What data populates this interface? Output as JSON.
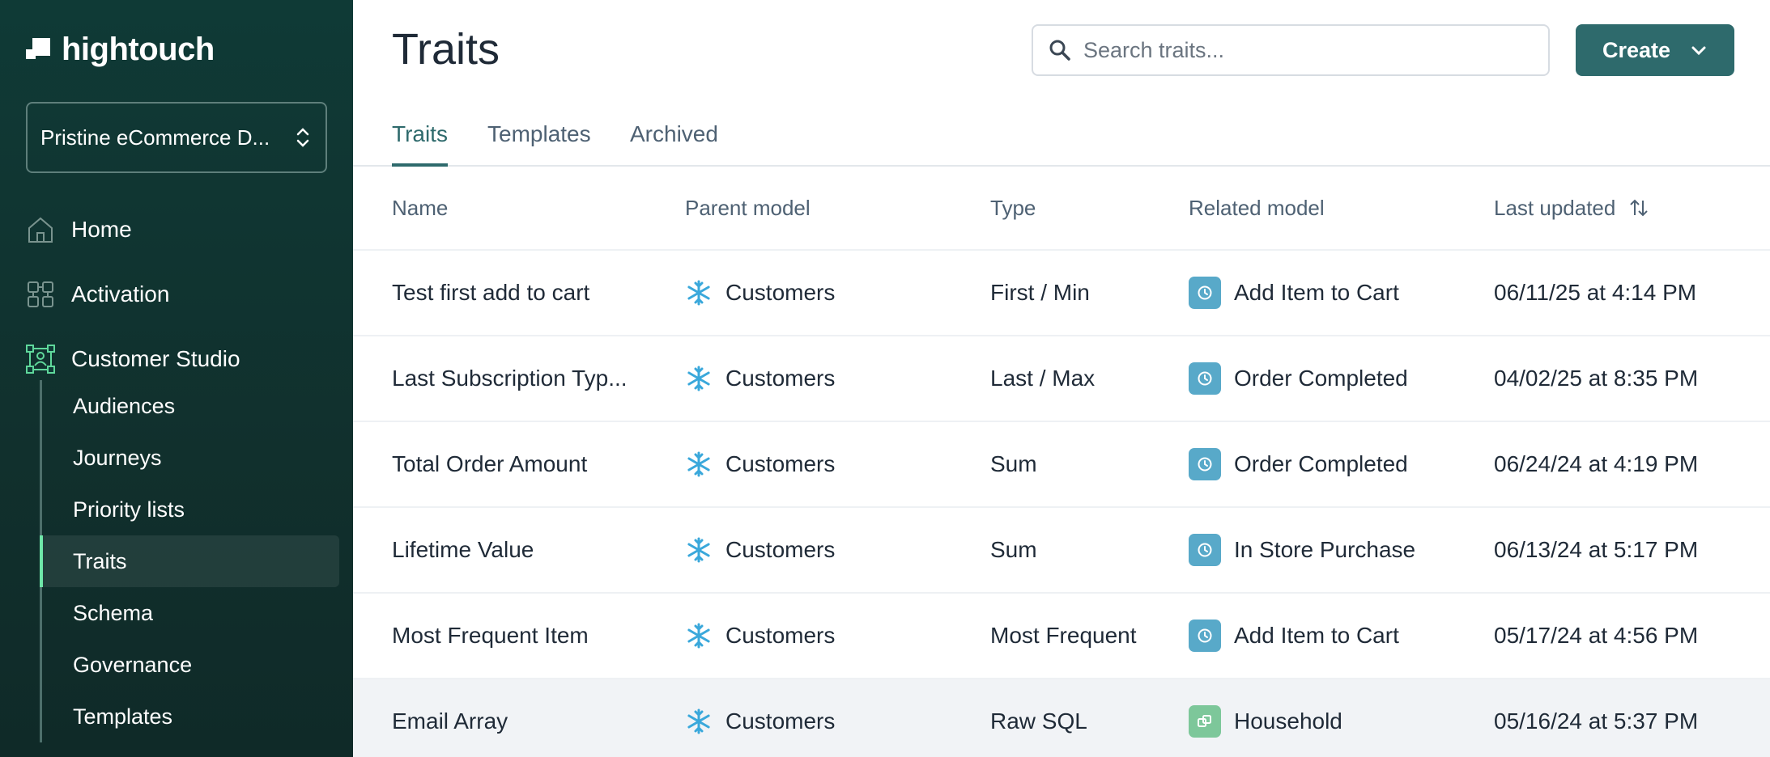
{
  "sidebar": {
    "logo_text": "hightouch",
    "workspace": "Pristine eCommerce D...",
    "nav": [
      {
        "label": "Home",
        "icon": "home-icon"
      },
      {
        "label": "Activation",
        "icon": "activation-icon"
      },
      {
        "label": "Customer Studio",
        "icon": "customer-studio-icon"
      }
    ],
    "subnav": [
      {
        "label": "Audiences"
      },
      {
        "label": "Journeys"
      },
      {
        "label": "Priority lists"
      },
      {
        "label": "Traits",
        "active": true
      },
      {
        "label": "Schema"
      },
      {
        "label": "Governance"
      },
      {
        "label": "Templates"
      }
    ]
  },
  "header": {
    "title": "Traits",
    "search_placeholder": "Search traits...",
    "create_label": "Create"
  },
  "tabs": [
    {
      "label": "Traits",
      "active": true
    },
    {
      "label": "Templates"
    },
    {
      "label": "Archived"
    }
  ],
  "table": {
    "columns": [
      "Name",
      "Parent model",
      "Type",
      "Related model",
      "Last updated"
    ],
    "rows": [
      {
        "name": "Test first add to cart",
        "parent": "Customers",
        "type": "First / Min",
        "related": "Add Item to Cart",
        "related_icon": "clock-icon",
        "updated": "06/11/25 at 4:14 PM"
      },
      {
        "name": "Last Subscription Typ...",
        "parent": "Customers",
        "type": "Last / Max",
        "related": "Order Completed",
        "related_icon": "clock-icon",
        "updated": "04/02/25 at 8:35 PM"
      },
      {
        "name": "Total Order Amount",
        "parent": "Customers",
        "type": "Sum",
        "related": "Order Completed",
        "related_icon": "clock-icon",
        "updated": "06/24/24 at 4:19 PM"
      },
      {
        "name": "Lifetime Value",
        "parent": "Customers",
        "type": "Sum",
        "related": "In Store Purchase",
        "related_icon": "clock-icon",
        "updated": "06/13/24 at 5:17 PM"
      },
      {
        "name": "Most Frequent Item",
        "parent": "Customers",
        "type": "Most Frequent",
        "related": "Add Item to Cart",
        "related_icon": "clock-icon",
        "updated": "05/17/24 at 4:56 PM"
      },
      {
        "name": "Email Array",
        "parent": "Customers",
        "type": "Raw SQL",
        "related": "Household",
        "related_icon": "cubes-icon",
        "updated": "05/16/24 at 5:37 PM"
      }
    ]
  },
  "colors": {
    "sidebar_bg": "#0f3a36",
    "accent": "#2e6a6c",
    "active_indicator": "#6ee7a8",
    "event_badge": "#58a9c9",
    "entity_badge": "#7dc79a",
    "snowflake": "#3aa8db"
  }
}
